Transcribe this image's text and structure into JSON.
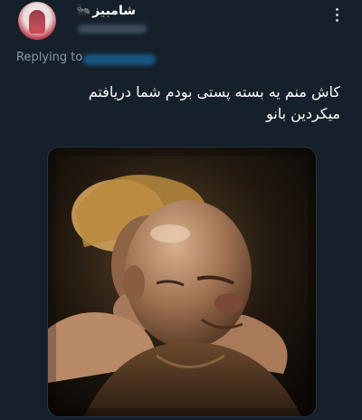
{
  "author": {
    "display_name": "شامبیز",
    "name_emoji": "🐜"
  },
  "reply_context": {
    "label": "Replying to"
  },
  "tweet": {
    "text_line1": "کاش منم یه بسته پستی بودم شما دریافتم",
    "text_line2": "میکردین بانو"
  },
  "icons": {
    "more": "more-vertical-icon"
  }
}
